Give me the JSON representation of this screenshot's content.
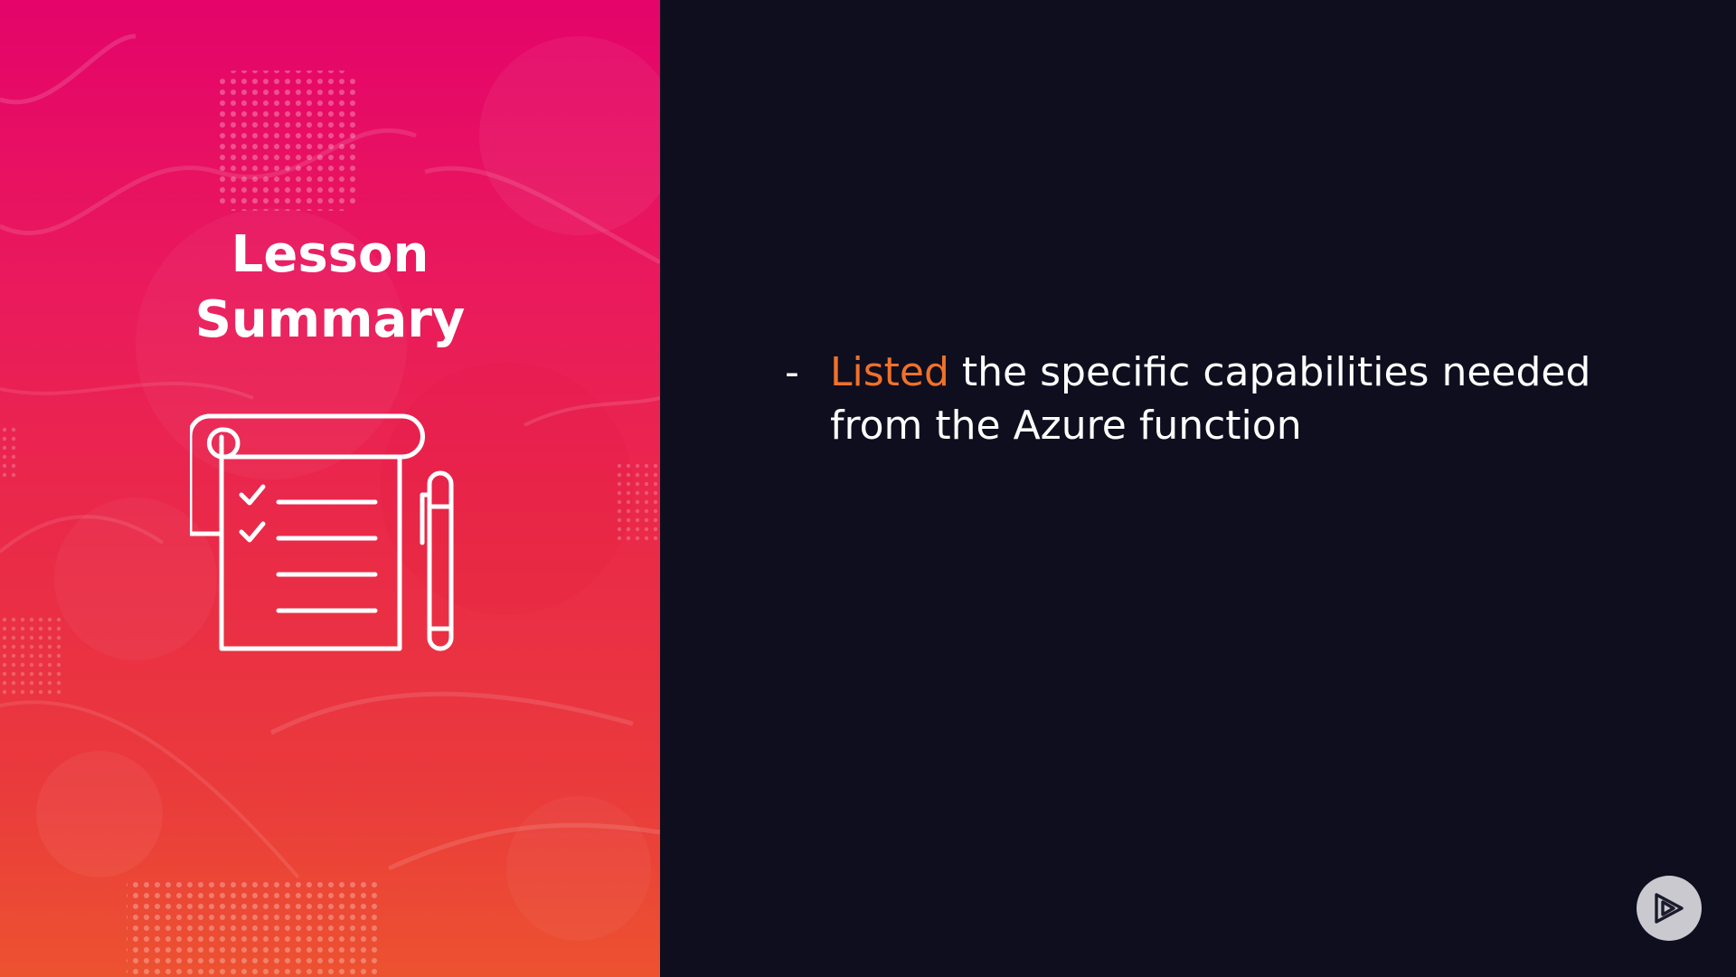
{
  "slide": {
    "title_line1": "Lesson",
    "title_line2": "Summary",
    "icon": "notepad-checklist-pen-icon"
  },
  "content": {
    "bullet_marker": "-",
    "bullets": [
      {
        "highlight": "Listed",
        "text": " the specific capabilities needed from the Azure function"
      }
    ]
  },
  "logo": {
    "icon": "play-logo-icon"
  },
  "colors": {
    "background": "#0f0e1f",
    "gradient_top": "#e4046a",
    "gradient_bottom": "#ec5230",
    "highlight": "#f0712a",
    "text": "#ffffff"
  }
}
